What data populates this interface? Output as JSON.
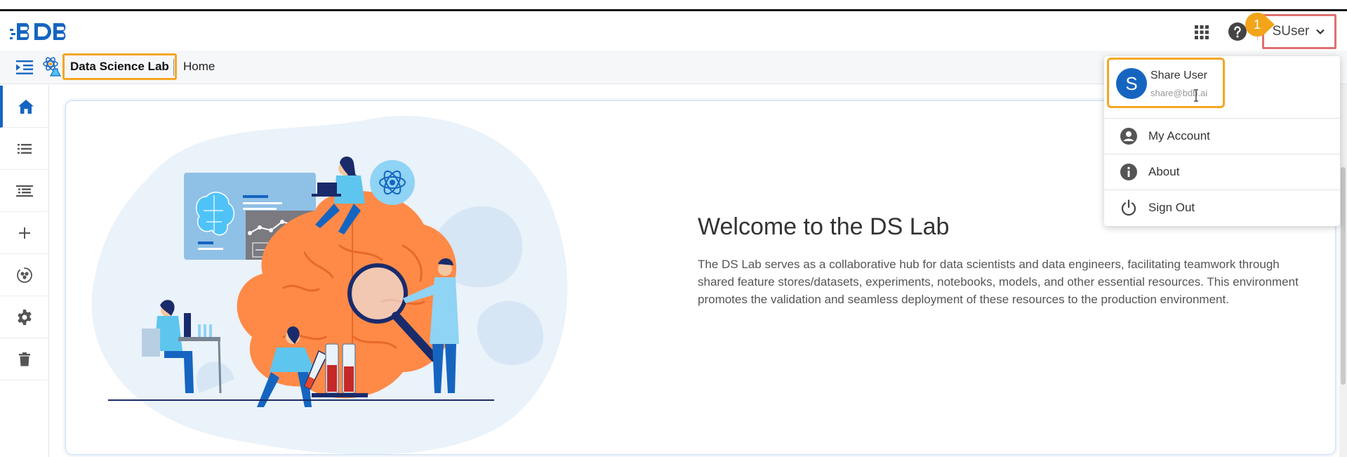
{
  "header": {
    "logo_text": "BDB",
    "apps_icon": "apps-grid-icon",
    "help_icon": "help-icon",
    "user_menu_label": "SUser",
    "step_marker": "1"
  },
  "breadcrumb": {
    "app_name": "Data Science Lab",
    "current": "Home"
  },
  "sidebar": {
    "items": [
      {
        "icon": "home-icon",
        "active": true
      },
      {
        "icon": "list-icon",
        "active": false
      },
      {
        "icon": "tasks-icon",
        "active": false
      },
      {
        "icon": "plus-icon",
        "active": false
      },
      {
        "icon": "model-hub-icon",
        "active": false
      },
      {
        "icon": "gear-icon",
        "active": false
      },
      {
        "icon": "trash-icon",
        "active": false
      }
    ]
  },
  "main": {
    "title": "Welcome to the DS Lab",
    "description": "The DS Lab serves as a collaborative hub for data scientists and data engineers, facilitating teamwork through shared feature stores/datasets, experiments, notebooks, models, and other essential resources. This environment promotes the validation and seamless deployment of these resources to the production environment."
  },
  "user_dropdown": {
    "avatar_letter": "S",
    "name": "Share User",
    "email": "share@bdb.ai",
    "items": [
      {
        "label": "My Account",
        "icon": "account-circle-icon"
      },
      {
        "label": "About",
        "icon": "info-icon"
      },
      {
        "label": "Sign Out",
        "icon": "power-icon"
      }
    ]
  },
  "colors": {
    "brand_blue": "#1565c0",
    "highlight_orange": "#f5a623",
    "highlight_red": "#e0706f",
    "brain_orange": "#ff8a47"
  }
}
